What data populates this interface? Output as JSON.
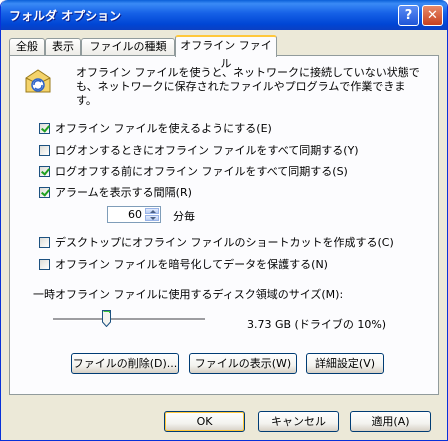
{
  "window": {
    "title": "フォルダ オプション",
    "help_glyph": "?",
    "close_glyph": "✕"
  },
  "tabs": [
    {
      "label": "全般"
    },
    {
      "label": "表示"
    },
    {
      "label": "ファイルの種類"
    },
    {
      "label": "オフライン ファイル",
      "active": true
    }
  ],
  "intro": {
    "text": "オフライン ファイルを使うと、ネットワークに接続していない状態でも、ネットワークに保存されたファイルやプログラムで作業できます。"
  },
  "options": [
    {
      "label": "オフライン ファイルを使えるようにする(E)",
      "checked": true
    },
    {
      "label": "ログオンするときにオフライン ファイルをすべて同期する(Y)",
      "checked": false
    },
    {
      "label": "ログオフする前にオフライン ファイルをすべて同期する(S)",
      "checked": true
    },
    {
      "label": "アラームを表示する間隔(R)",
      "checked": true
    }
  ],
  "reminder": {
    "value": "60",
    "unit": "分毎"
  },
  "options2": [
    {
      "label": "デスクトップにオフライン ファイルのショートカットを作成する(C)",
      "checked": false
    },
    {
      "label": "オフライン ファイルを暗号化してデータを保護する(N)",
      "checked": false
    }
  ],
  "disk": {
    "label": "一時オフライン ファイルに使用するディスク領域のサイズ(M):",
    "value_text": "3.73 GB (ドライブの 10%)",
    "slider_fraction": 0.1
  },
  "panel_buttons": {
    "delete": "ファイルの削除(D)...",
    "view": "ファイルの表示(W)",
    "advanced": "詳細設定(V)"
  },
  "dialog_buttons": {
    "ok": "OK",
    "cancel": "キャンセル",
    "apply": "適用(A)"
  }
}
